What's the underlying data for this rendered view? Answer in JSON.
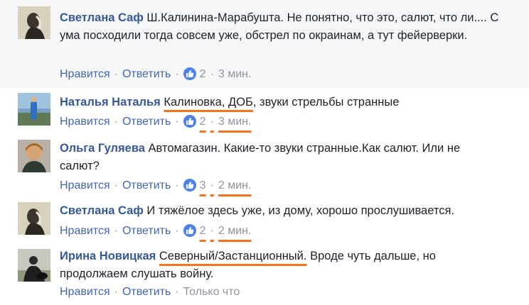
{
  "comments": [
    {
      "author": "Светлана Саф",
      "avatar_icon": "avatar-photo-icon",
      "text": "Ш.Калинина-Марабушта. Не понятно, что это, салют, что ли.... С ума посходили тогда совсем уже, обстрел по окраинам, а тут фейерверки.",
      "like_label": "Нравится",
      "reply_label": "Ответить",
      "reaction_count": "2",
      "time": "3 мин."
    },
    {
      "author": "Наталья Наталья",
      "avatar_icon": "avatar-photo-icon",
      "text_highlight": "Калиновка, ДОБ",
      "text_rest": ", звуки стрельбы странные",
      "like_label": "Нравится",
      "reply_label": "Ответить",
      "reaction_count": "2",
      "time": "3 мин."
    },
    {
      "author": "Ольга Гуляева",
      "avatar_icon": "avatar-photo-icon",
      "text": "Автомагазин. Какие-то звуки странные.Как салют. Или не салют?",
      "like_label": "Нравится",
      "reply_label": "Ответить",
      "reaction_count": "3",
      "time": "2 мин."
    },
    {
      "author": "Светлана Саф",
      "avatar_icon": "avatar-photo-icon",
      "text": "И тяжёлое здесь уже, из дому, хорошо прослушивается.",
      "like_label": "Нравится",
      "reply_label": "Ответить",
      "reaction_count": "2",
      "time": "2 мин."
    },
    {
      "author": "Ирина Новицкая",
      "avatar_icon": "avatar-photo-icon",
      "text_highlight": "Северный/Застанционный.",
      "text_rest": " Вроде чуть дальше, но продолжаем слушать войну.",
      "like_label": "Нравится",
      "reply_label": "Ответить",
      "time": "Только что"
    }
  ],
  "reaction_icon": "thumbs-up-icon",
  "colors": {
    "author_link": "#365899",
    "action_link": "#4267b2",
    "meta_gray": "#90949c",
    "highlight_underline": "#f07425",
    "like_badge": "#4c80ec",
    "row_background": "#f6f7f9"
  }
}
